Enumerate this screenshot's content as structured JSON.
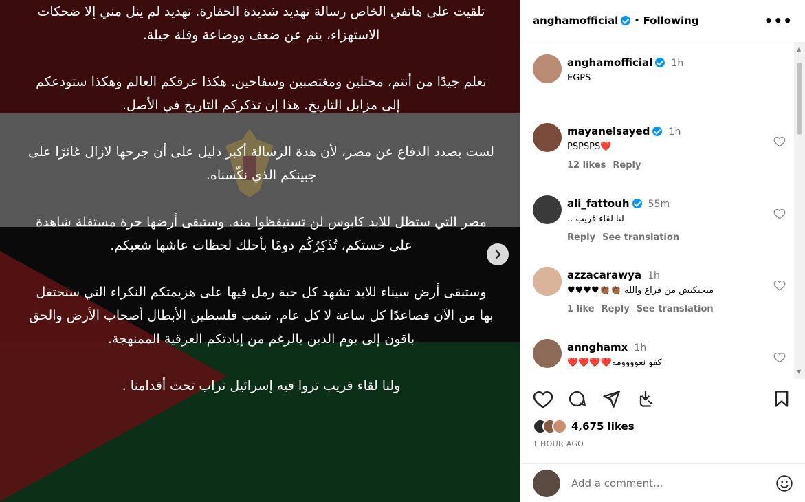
{
  "post": {
    "media_text": [
      "تلقيت على هاتفي الخاص رسالة تهديد شديدة الحقارة. تهديد لم ينل مني إلا ضحكات الاستهزاء، ينم عن ضعف ووضاعة وقلة حيلة.",
      "نعلم جيدًا من أنتم، محتلين ومغتصبين وسفاحين. هكذا عرفكم العالم وهكذا ستودعكم إلى مزابل التاريخ. هذا إن تذكركم التاريخ في الأصل.",
      "لست بصدد الدفاع عن مصر، لأن هذة الرسالة أكبر دليل على أن جرحها لازال غائرًا على جبينكم الذي نكّسناه.",
      "مصر التي ستظل للابد كابوس لن تستيقظوا منه. وستبقى أرضها حرة مستقلة شاهدة على خستكم، تُذَكِرُكُم دومًا بأحلك لحظات عاشها شعبكم.",
      "وستبقى أرض سيناء للابد تشهد كل حبة رمل فيها على هزيمتكم النكراء التي سنحتفل بها من الآن فصاعدًا كل ساعة لا كل عام. شعب فلسطين الأبطال أصحاب الأرض والحق باقون إلى يوم الدين بالرغم من إبادتكم العرقية الممنهجة.",
      "ولنا لقاء قريب تروا فيه إسرائيل تراب تحت أقدامنا ."
    ]
  },
  "header": {
    "username": "anghamofficial",
    "separator": "•",
    "follow_state": "Following",
    "more": "•••"
  },
  "comments": [
    {
      "user": "anghamofficial",
      "time": "1h",
      "text": "EGPS",
      "verified": true,
      "likes": "",
      "reply": "",
      "translate": "",
      "avatar_color": "#b98b72"
    },
    {
      "user": "mayanelsayed",
      "time": "1h",
      "text": "PSPSPS❤️",
      "verified": true,
      "likes": "12 likes",
      "reply": "Reply",
      "translate": "",
      "avatar_color": "#7a4a3a"
    },
    {
      "user": "ali_fattouh",
      "time": "55m",
      "text": "لنا لقاء قريب ..",
      "verified": true,
      "likes": "",
      "reply": "Reply",
      "translate": "See translation",
      "avatar_color": "#3a3a3a"
    },
    {
      "user": "azzacarawya",
      "time": "1h",
      "text": "مبحبكيش من فراغ والله 👏🏾👏🏾♥♥♥♥",
      "verified": false,
      "likes": "1 like",
      "reply": "Reply",
      "translate": "See translation",
      "avatar_color": "#d9b49a"
    },
    {
      "user": "annghamx",
      "time": "1h",
      "text": "كفو نغوووومه❤️❤️❤️❤️",
      "verified": false,
      "likes": "",
      "reply": "",
      "translate": "",
      "avatar_color": "#8d6a58"
    }
  ],
  "footer": {
    "likes": "4,675 likes",
    "time_ago": "1 HOUR AGO",
    "comment_placeholder": "Add a comment..."
  }
}
